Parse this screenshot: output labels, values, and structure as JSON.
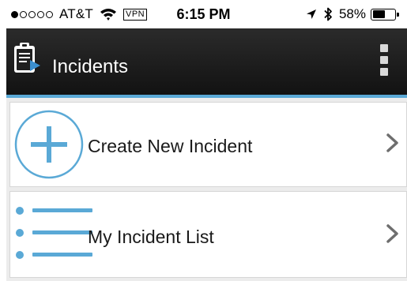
{
  "status_bar": {
    "signal": {
      "bars_total": 5,
      "bars_filled": 1
    },
    "carrier": "AT&T",
    "vpn_label": "VPN",
    "time": "6:15 PM",
    "battery_text": "58%",
    "battery_level": 0.58
  },
  "header": {
    "title": "Incidents"
  },
  "menu": [
    {
      "label": "Create New Incident",
      "icon": "plus-circle-icon"
    },
    {
      "label": "My Incident List",
      "icon": "list-icon"
    }
  ],
  "colors": {
    "accent": "#5aa9d6",
    "header_bg": "#1e1e1e",
    "list_bg": "#ececec"
  }
}
